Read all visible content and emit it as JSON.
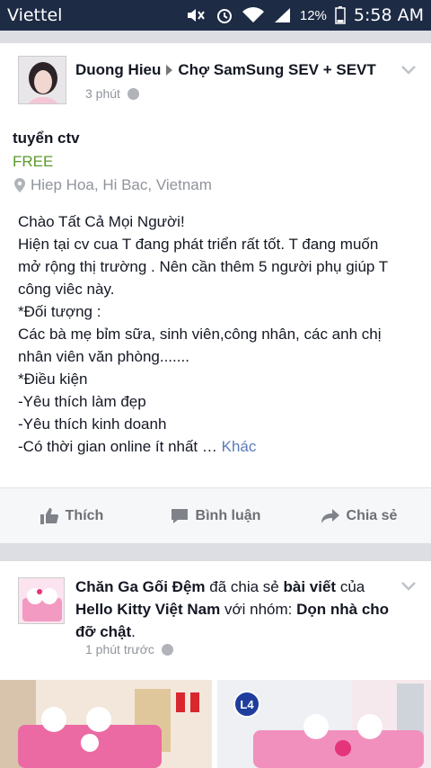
{
  "status_bar": {
    "carrier": "Viettel",
    "battery_percent": "12%",
    "time": "5:58 AM",
    "icons": [
      "mute-icon",
      "alarm-icon",
      "wifi-icon",
      "signal-icon",
      "battery-icon"
    ],
    "background": "#1d2b45"
  },
  "post1": {
    "author": "Duong Hieu",
    "group": "Chợ SamSung SEV + SEVT",
    "time": "3 phút",
    "sale": {
      "title": "tuyển ctv",
      "price": "FREE",
      "location": "Hiep Hoa, Hi Bac, Vietnam"
    },
    "body_lines": [
      "Chào Tất Cả Mọi Người!",
      "Hiện tại cv cua T đang phát triển rất tốt. T đang muốn",
      "mở rộng thị trường . Nên cần thêm 5 người phụ giúp T",
      "công viêc này.",
      "*Đối tượng :",
      "Các bà mẹ bỉm sữa, sinh viên,công nhân, các anh chị",
      "nhân viên văn phòng.......",
      "*Điều kiện",
      "-Yêu thích làm đẹp",
      "-Yêu thích kinh doanh",
      "-Có thời gian online ít nhất …"
    ],
    "more_label": "Khác",
    "actions": {
      "like": "Thích",
      "comment": "Bình luận",
      "share": "Chia sẻ"
    }
  },
  "post2": {
    "page_name": "Chăn Ga Gối Đệm",
    "shared_text": "đã chia sẻ",
    "post_word": "bài viết",
    "of_text": "của",
    "source_page": "Hello Kitty Việt Nam",
    "with_group_text": "với nhóm:",
    "group_name": "Dọn nhà cho đỡ chật",
    "time": "1 phút trước",
    "badge": "L4"
  },
  "colors": {
    "price_green": "#5b9b2a",
    "link_blue": "#5b7bb8",
    "meta_gray": "#90949c",
    "feed_bg": "#dcdee3"
  }
}
